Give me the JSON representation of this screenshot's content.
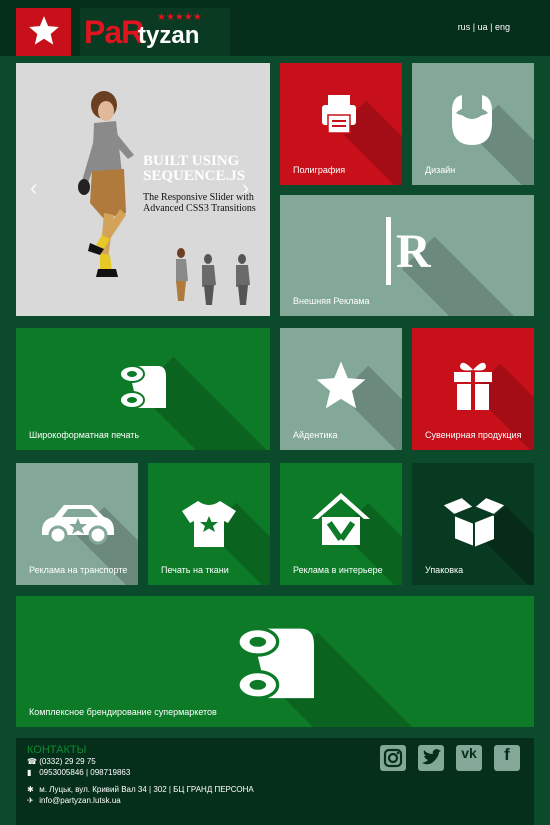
{
  "header": {
    "logo_pa": "Pa",
    "logo_r": "R",
    "logo_tyzan": "tyzan",
    "logo_stars": "★★★★★",
    "languages": [
      "rus",
      "ua",
      "eng"
    ],
    "lang_separator": "|"
  },
  "slider": {
    "headline": "BUILT USING SEQUENCE.JS",
    "subtitle": "The Responsive Slider with Advanced CSS3 Transitions",
    "prev_arrow": "‹",
    "next_arrow": "›"
  },
  "tiles": {
    "poligrafiya": "Полиграфия",
    "dizain": "Дизайн",
    "vneshnyaya": "Внешняя Реклама",
    "shirokoformat": "Широкоформатная печать",
    "aidentika": "Айдентика",
    "suvenir": "Сувенирная продукция",
    "transport": "Реклама на транспорте",
    "tkani": "Печать на ткани",
    "interier": "Реклама в интерьере",
    "upakovka": "Упаковка",
    "kompleks": "Комплексное брендирование супермаркетов"
  },
  "footer": {
    "title": "КОНТАКТЫ",
    "phone1": "(0332) 29 29 75",
    "phone2": "0953005846 | 098719863",
    "address": "м. Луцьк, вул. Кривий Вал 34 | 302 | БЦ ГРАНД ПЕРСОНА",
    "email": "info@partyzan.lutsk.ua",
    "social": [
      "instagram-icon",
      "twitter-icon",
      "vk-icon",
      "facebook-icon"
    ]
  },
  "colors": {
    "background": "#0b4b2c",
    "red": "#c8101a",
    "sage": "#83a898",
    "green": "#0d7a28",
    "dark": "#083a21"
  }
}
